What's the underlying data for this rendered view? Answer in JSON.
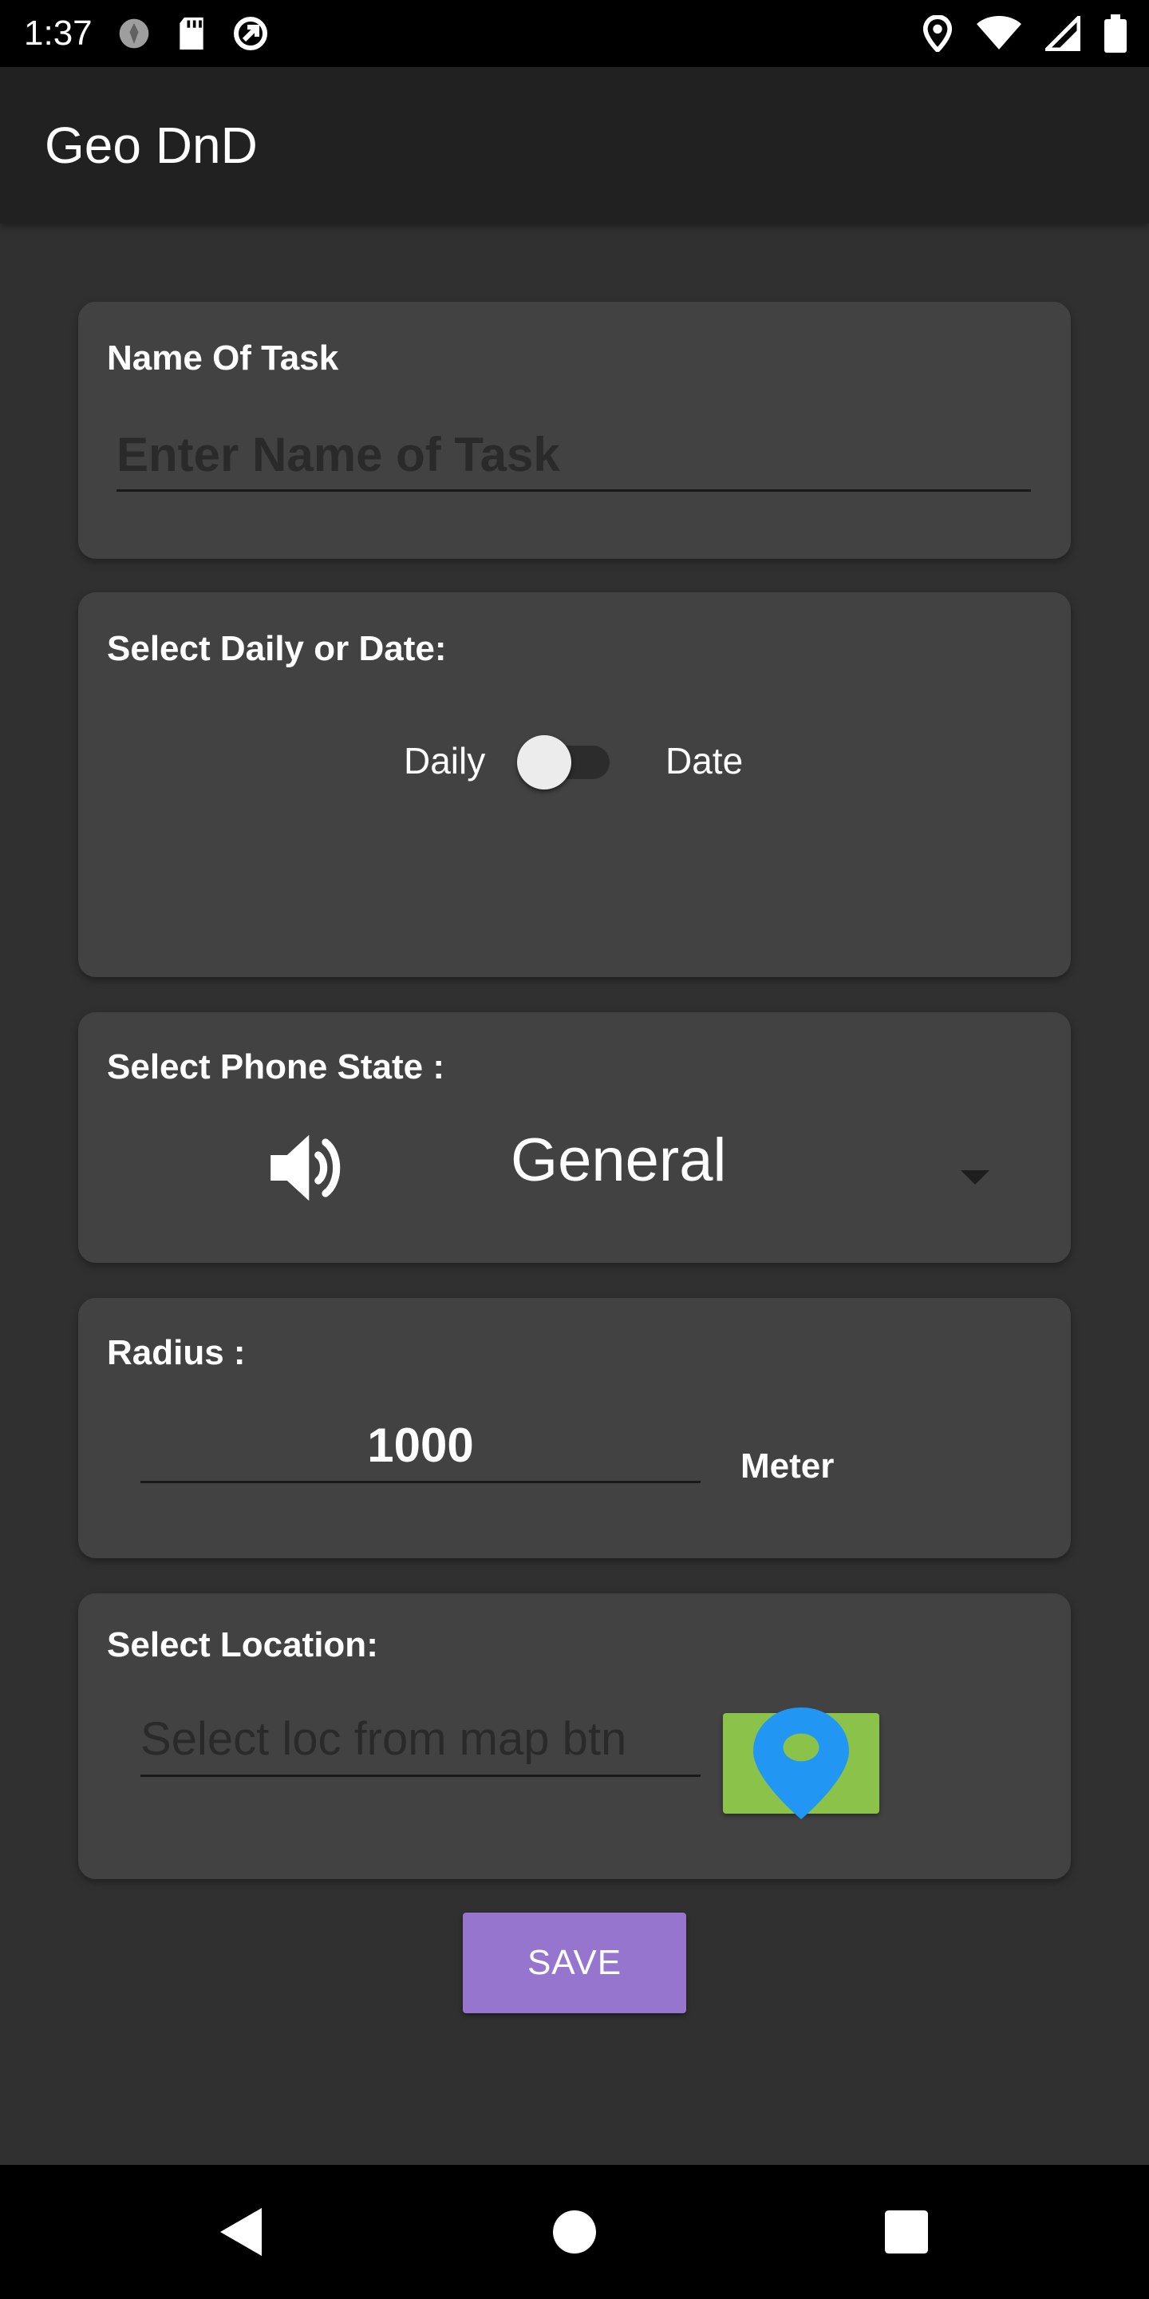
{
  "status_bar": {
    "time": "1:37"
  },
  "app_bar": {
    "title": "Geo DnD"
  },
  "task_name": {
    "label": "Name Of Task",
    "placeholder": "Enter Name of Task",
    "value": ""
  },
  "schedule": {
    "label": "Select Daily or Date:",
    "left_option": "Daily",
    "right_option": "Date",
    "toggle_on": false
  },
  "phone_state": {
    "label": "Select Phone State :",
    "selected": "General",
    "icon": "speaker-icon"
  },
  "radius": {
    "label": "Radius :",
    "value": "1000",
    "unit": "Meter"
  },
  "location": {
    "label": "Select Location:",
    "placeholder": "Select loc from map btn",
    "value": "",
    "button_icon": "map-pin-icon"
  },
  "actions": {
    "save_label": "SAVE"
  },
  "colors": {
    "background": "#303030",
    "app_bar": "#212121",
    "card": "#424242",
    "save_button": "#9575cd",
    "map_button": "#8bc34a",
    "pin": "#2196f3"
  }
}
